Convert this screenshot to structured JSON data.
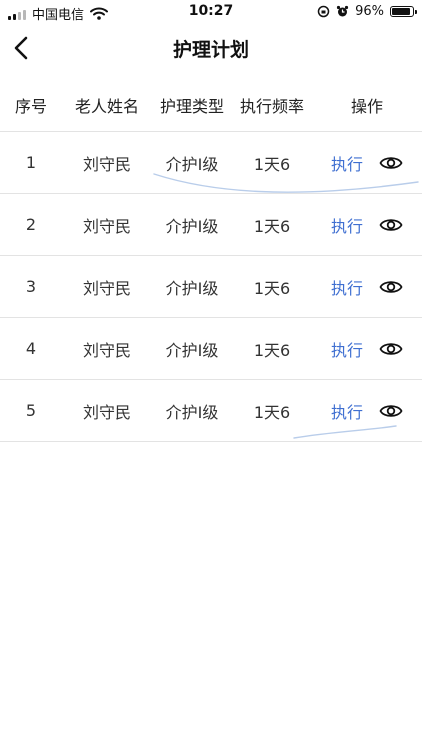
{
  "status_bar": {
    "carrier": "中国电信",
    "time": "10:27",
    "battery": "96%",
    "battery_level": 0.96
  },
  "nav": {
    "title": "护理计划",
    "back_icon": "chevron-left-icon"
  },
  "table": {
    "headers": [
      "序号",
      "老人姓名",
      "护理类型",
      "执行频率",
      "操作"
    ],
    "rows": [
      {
        "index": "1",
        "name": "刘守民",
        "type": "介护Ⅰ级",
        "frequency": "1天6",
        "action": "执行",
        "view_icon": "eye-icon"
      },
      {
        "index": "2",
        "name": "刘守民",
        "type": "介护Ⅰ级",
        "frequency": "1天6",
        "action": "执行",
        "view_icon": "eye-icon"
      },
      {
        "index": "3",
        "name": "刘守民",
        "type": "介护Ⅰ级",
        "frequency": "1天6",
        "action": "执行",
        "view_icon": "eye-icon"
      },
      {
        "index": "4",
        "name": "刘守民",
        "type": "介护Ⅰ级",
        "frequency": "1天6",
        "action": "执行",
        "view_icon": "eye-icon"
      },
      {
        "index": "5",
        "name": "刘守民",
        "type": "介护Ⅰ级",
        "frequency": "1天6",
        "action": "执行",
        "view_icon": "eye-icon"
      }
    ]
  },
  "colors": {
    "link": "#3f6fd1",
    "divider": "#e3e3e3",
    "scribble": "#b9cdea"
  }
}
